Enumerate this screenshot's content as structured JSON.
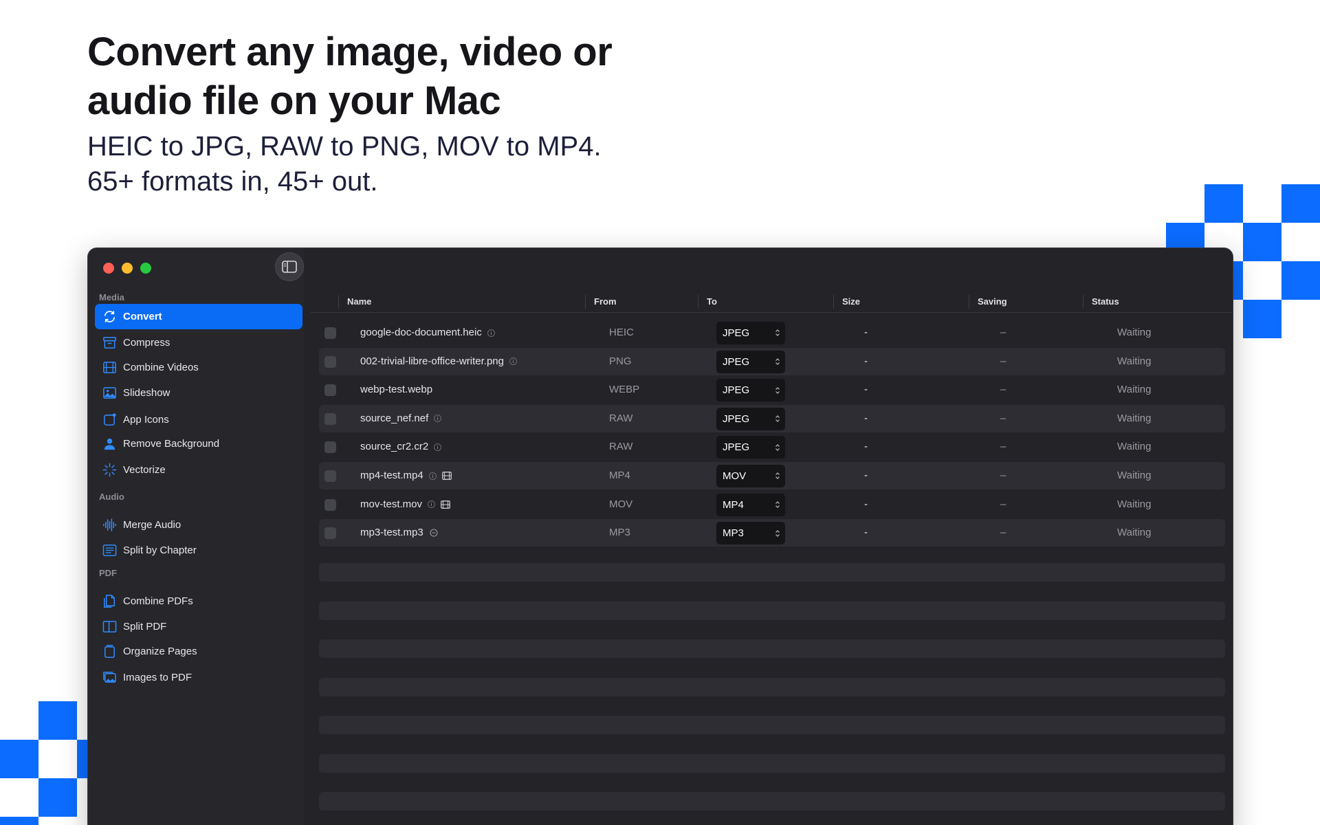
{
  "marketing": {
    "headline_line1": "Convert any image, video or",
    "headline_line2": "audio file on your Mac",
    "sub_line1": "HEIC to JPG, RAW to PNG, MOV to MP4.",
    "sub_line2": "65+ formats in, 45+ out."
  },
  "colors": {
    "accent": "#0a6cf5",
    "decor": "#0b6cff",
    "window_bg": "#232328",
    "sidebar_bg": "#26262b"
  },
  "sidebar": {
    "sections": [
      {
        "label": "Media",
        "items": [
          {
            "label": "Convert",
            "icon": "convert-arrows-icon",
            "active": true
          },
          {
            "label": "Compress",
            "icon": "archive-box-icon"
          },
          {
            "label": "Combine Videos",
            "icon": "film-icon"
          },
          {
            "label": "Slideshow",
            "icon": "photo-icon"
          },
          {
            "label": "App Icons",
            "icon": "app-square-icon"
          },
          {
            "label": "Remove Background",
            "icon": "person-icon"
          },
          {
            "label": "Vectorize",
            "icon": "sparkle-icon"
          }
        ]
      },
      {
        "label": "Audio",
        "items": [
          {
            "label": "Merge Audio",
            "icon": "waveform-icon"
          },
          {
            "label": "Split by Chapter",
            "icon": "list-icon"
          }
        ]
      },
      {
        "label": "PDF",
        "items": [
          {
            "label": "Combine PDFs",
            "icon": "documents-icon"
          },
          {
            "label": "Split PDF",
            "icon": "split-page-icon"
          },
          {
            "label": "Organize Pages",
            "icon": "pages-icon"
          },
          {
            "label": "Images to PDF",
            "icon": "photos-icon"
          }
        ]
      }
    ]
  },
  "table": {
    "columns": [
      "Name",
      "From",
      "To",
      "Size",
      "Saving",
      "Status"
    ],
    "rows": [
      {
        "name": "google-doc-document.heic",
        "from": "HEIC",
        "to": "JPEG",
        "size": "-",
        "saving": "–",
        "status": "Waiting",
        "extra": "info"
      },
      {
        "name": "002-trivial-libre-office-writer.png",
        "from": "PNG",
        "to": "JPEG",
        "size": "-",
        "saving": "–",
        "status": "Waiting",
        "extra": "info"
      },
      {
        "name": "webp-test.webp",
        "from": "WEBP",
        "to": "JPEG",
        "size": "-",
        "saving": "–",
        "status": "Waiting",
        "extra": "none"
      },
      {
        "name": "source_nef.nef",
        "from": "RAW",
        "to": "JPEG",
        "size": "-",
        "saving": "–",
        "status": "Waiting",
        "extra": "info"
      },
      {
        "name": "source_cr2.cr2",
        "from": "RAW",
        "to": "JPEG",
        "size": "-",
        "saving": "–",
        "status": "Waiting",
        "extra": "info"
      },
      {
        "name": "mp4-test.mp4",
        "from": "MP4",
        "to": "MOV",
        "size": "-",
        "saving": "–",
        "status": "Waiting",
        "extra": "info-film"
      },
      {
        "name": "mov-test.mov",
        "from": "MOV",
        "to": "MP4",
        "size": "-",
        "saving": "–",
        "status": "Waiting",
        "extra": "info-film"
      },
      {
        "name": "mp3-test.mp3",
        "from": "MP3",
        "to": "MP3",
        "size": "-",
        "saving": "–",
        "status": "Waiting",
        "extra": "minus"
      }
    ]
  }
}
